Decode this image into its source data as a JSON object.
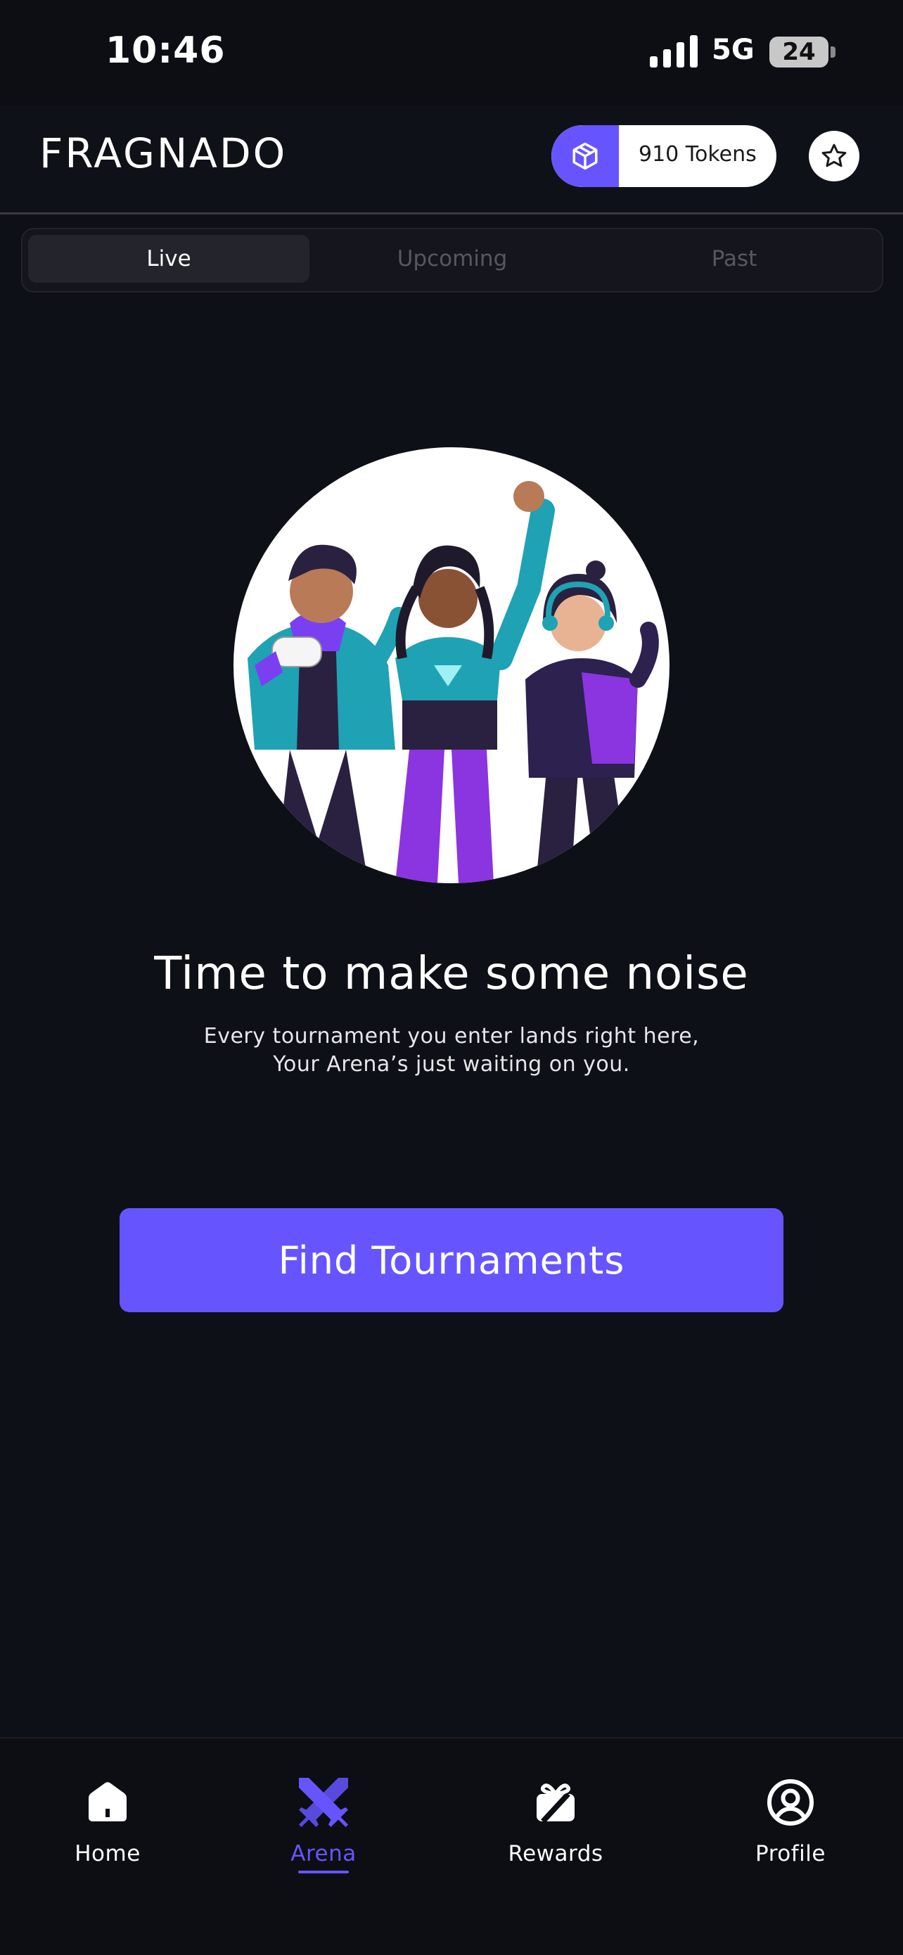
{
  "status_bar": {
    "time": "10:46",
    "network": "5G",
    "battery": "24"
  },
  "header": {
    "brand": "FRAGNADO",
    "tokens_label": "910 Tokens",
    "token_icon": "cube-icon",
    "favorites_icon": "star-icon"
  },
  "tabs": [
    {
      "label": "Live",
      "active": true
    },
    {
      "label": "Upcoming",
      "active": false
    },
    {
      "label": "Past",
      "active": false
    }
  ],
  "empty_state": {
    "illustration": "gamers-illustration",
    "title": "Time to make some noise",
    "subtitle_line1": "Every tournament you enter lands right here,",
    "subtitle_line2": "Your Arena’s just waiting on you."
  },
  "cta": {
    "label": "Find Tournaments"
  },
  "bottom_nav": [
    {
      "label": "Home",
      "icon": "home-icon",
      "active": false
    },
    {
      "label": "Arena",
      "icon": "crossed-swords-icon",
      "active": true
    },
    {
      "label": "Rewards",
      "icon": "gift-icon",
      "active": false
    },
    {
      "label": "Profile",
      "icon": "user-icon",
      "active": false
    }
  ],
  "colors": {
    "background": "#0e1017",
    "accent": "#6655ff",
    "tab_active": "#24252c",
    "tab_inactive_text": "#565860"
  }
}
